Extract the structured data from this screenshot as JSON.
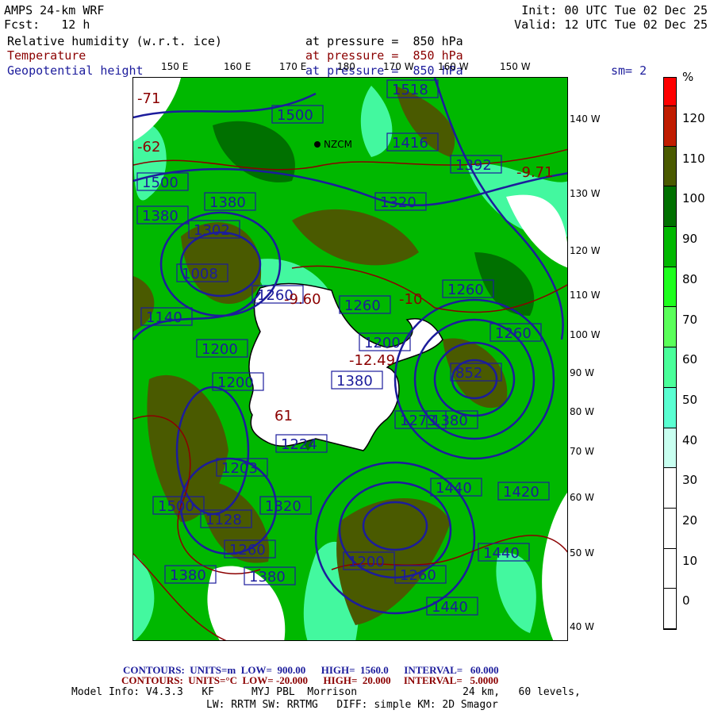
{
  "header": {
    "model": "AMPS 24-km WRF",
    "forecast": "Fcst:   12 h",
    "init": "Init: 00 UTC Tue 02 Dec 25",
    "valid": "Valid: 12 UTC Tue 02 Dec 25",
    "fields": [
      {
        "name": "Relative humidity (w.r.t. ice)",
        "level": "at pressure =  850 hPa"
      },
      {
        "name": "Temperature",
        "level": "at pressure =  850 hPa"
      },
      {
        "name": "Geopotential height",
        "level": "at pressure =  850 hPa"
      }
    ],
    "smoothing": "sm= 2"
  },
  "map": {
    "lon_labels": [
      "150 E",
      "160 E",
      "170 E",
      "180",
      "170 W",
      "160 W",
      "150 W"
    ],
    "lat_labels": [
      "140 W",
      "130 W",
      "120 W",
      "110 W",
      "100 W",
      "90 W",
      "80 W",
      "70 W",
      "60 W",
      "50 W",
      "40 W"
    ],
    "height_labels": [
      "1518",
      "1500",
      "1416",
      "1500",
      "1380",
      "1380",
      "1302",
      "1392",
      "1320",
      "1008",
      "1260",
      "1260",
      "1380",
      "1140",
      "1260",
      "1200",
      "1200",
      "852",
      "1260",
      "1200",
      "1273",
      "1224",
      "1203",
      "1380",
      "1320",
      "1128",
      "1260",
      "1440",
      "1440",
      "1380",
      "1500",
      "1380",
      "1420",
      "1440",
      "1440",
      "1200",
      "1260"
    ],
    "temp_labels": [
      "-71",
      "-62",
      "-9.60",
      "-12.49",
      "-9.71",
      "61",
      "-10"
    ],
    "station": "NZCM",
    "colors": {
      "height_contour": "#1c1c9c",
      "temp_contour": "#8b0000"
    }
  },
  "colorbar": {
    "unit": "%",
    "ticks": [
      "120",
      "110",
      "100",
      "90",
      "80",
      "70",
      "60",
      "50",
      "40",
      "30",
      "20",
      "10",
      "0"
    ],
    "colors": [
      "#ff0000",
      "#c01c00",
      "#4a5a00",
      "#007000",
      "#00b800",
      "#1eff1e",
      "#5aff5a",
      "#4aff9a",
      "#5affd2",
      "#c8fff0",
      "#ffffff",
      "#ffffff",
      "#ffffff",
      "#ffffff"
    ]
  },
  "footer": {
    "height_contours": {
      "label": "CONTOURS:",
      "units": "UNITS=m",
      "low": "LOW=  900.00",
      "high": "HIGH=  1560.0",
      "interval": "INTERVAL=   60.000"
    },
    "temp_contours": {
      "label": "CONTOURS:",
      "units": "UNITS=°C",
      "low": "LOW= -20.000",
      "high": "HIGH=  20.000",
      "interval": "INTERVAL=   5.0000"
    },
    "model_info": "Model Info: V4.3.3   KF      MYJ PBL  Morrison                 24 km,   60 levels,",
    "physics": "LW: RRTM SW: RRTMG   DIFF: simple KM: 2D Smagor"
  }
}
